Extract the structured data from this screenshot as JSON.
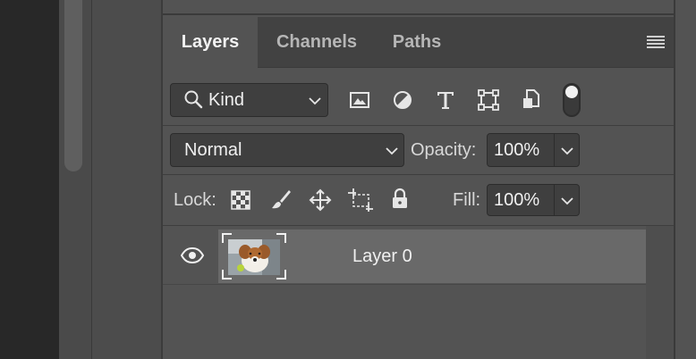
{
  "tabs": [
    {
      "label": "Layers",
      "active": true
    },
    {
      "label": "Channels",
      "active": false
    },
    {
      "label": "Paths",
      "active": false
    }
  ],
  "filter": {
    "kind_label": "Kind",
    "icons": [
      "pixel-layer-filter-icon",
      "adjustment-layer-filter-icon",
      "type-layer-filter-icon",
      "shape-layer-filter-icon",
      "smart-object-filter-icon",
      "filter-toggle-icon"
    ]
  },
  "blend": {
    "mode": "Normal",
    "opacity_label": "Opacity:",
    "opacity_value": "100%"
  },
  "lock": {
    "label": "Lock:",
    "icons": [
      "lock-transparent-pixels-icon",
      "lock-image-pixels-icon",
      "lock-position-icon",
      "lock-artboard-icon",
      "lock-all-icon"
    ],
    "fill_label": "Fill:",
    "fill_value": "100%"
  },
  "layers": [
    {
      "name": "Layer 0",
      "visible": true,
      "thumbnail": "dog-with-ball-thumbnail"
    }
  ],
  "colors": {
    "panel_bg": "#535353",
    "tabbar_bg": "#424242",
    "field_bg": "#3f3f3f",
    "selected_layer": "#696969"
  }
}
